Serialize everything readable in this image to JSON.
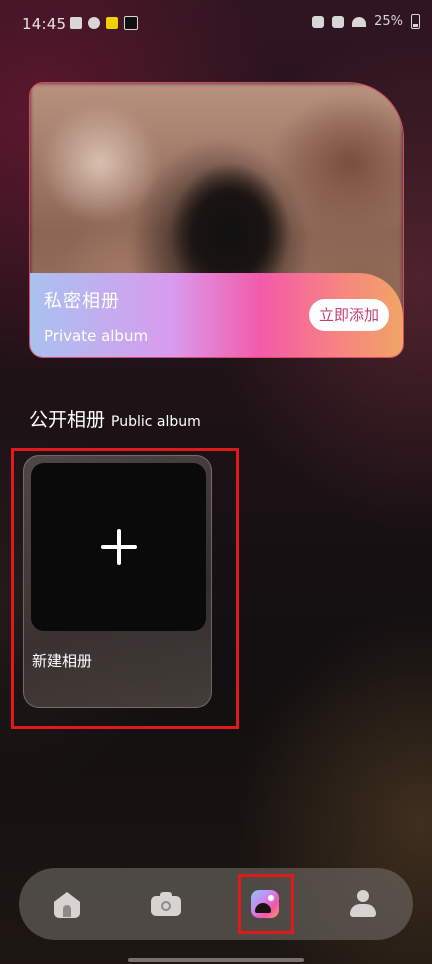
{
  "status_bar": {
    "time": "14:45",
    "battery": "25%"
  },
  "private_album": {
    "title": "私密相册",
    "subtitle": "Private album",
    "add_button_label": "立即添加"
  },
  "public_album": {
    "title": "公开相册",
    "subtitle": "Public album",
    "new_album_label": "新建相册"
  },
  "bottom_nav": {
    "items": [
      {
        "icon": "home-icon",
        "active": false
      },
      {
        "icon": "camera-icon",
        "active": false
      },
      {
        "icon": "album-icon",
        "active": true
      },
      {
        "icon": "profile-icon",
        "active": false
      }
    ]
  },
  "colors": {
    "highlight": "#e01a1a",
    "add_button_text": "#c33e74",
    "card_border": "#d84a63"
  }
}
